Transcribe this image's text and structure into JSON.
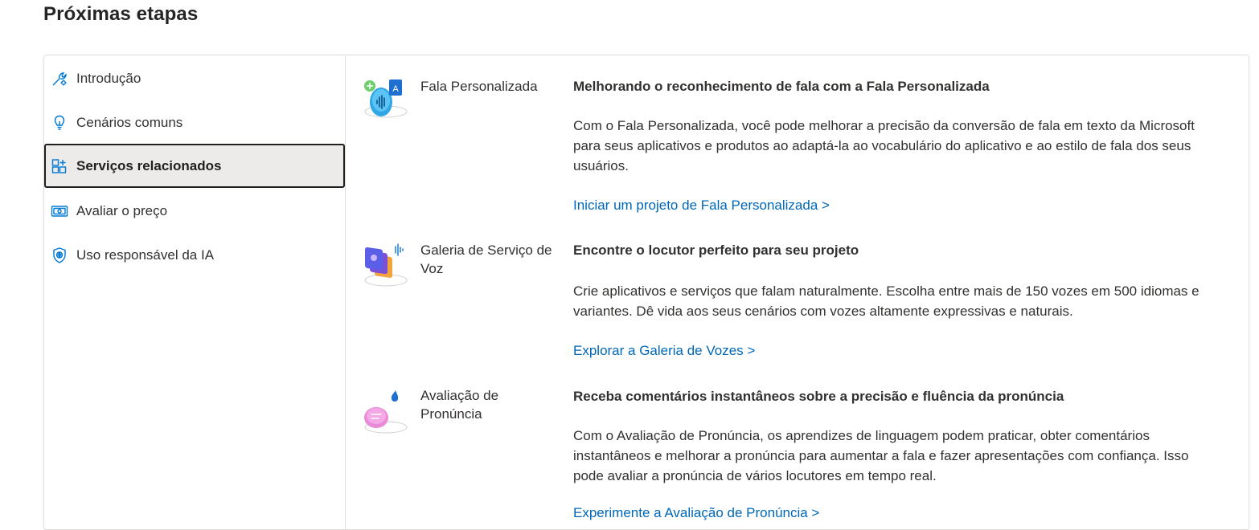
{
  "page": {
    "title": "Próximas etapas"
  },
  "sidebar": {
    "items": [
      {
        "label": "Introdução",
        "icon": "wrench-gear-icon",
        "active": false
      },
      {
        "label": "Cenários comuns",
        "icon": "lightbulb-icon",
        "active": false
      },
      {
        "label": "Serviços relacionados",
        "icon": "grid-add-icon",
        "active": true
      },
      {
        "label": "Avaliar o preço",
        "icon": "money-icon",
        "active": false
      },
      {
        "label": "Uso responsável da IA",
        "icon": "shield-globe-icon",
        "active": false
      }
    ]
  },
  "services": [
    {
      "name": "Fala Personalizada",
      "heading": "Melhorando o reconhecimento de fala com a Fala Personalizada",
      "description": "Com o Fala Personalizada, você pode melhorar a precisão da conversão de fala em texto da Microsoft para seus aplicativos e produtos ao adaptá-la ao vocabulário do aplicativo e ao estilo de fala dos seus usuários.",
      "link": "Iniciar um projeto de Fala Personalizada >",
      "illustration": "custom-speech-illustration"
    },
    {
      "name": "Galeria de Serviço de Voz",
      "heading": "Encontre o locutor perfeito para seu projeto",
      "description": "Crie aplicativos e serviços que falam naturalmente. Escolha entre mais de 150 vozes em 500 idiomas e variantes. Dê vida aos seus cenários com vozes altamente expressivas e naturais.",
      "link": "Explorar a Galeria de Vozes >",
      "illustration": "voice-gallery-illustration"
    },
    {
      "name": "Avaliação de Pronúncia",
      "heading": "Receba comentários instantâneos sobre a precisão e fluência da pronúncia",
      "description": "Com o Avaliação de Pronúncia, os aprendizes de linguagem podem praticar, obter comentários instantâneos e melhorar a pronúncia para aumentar a fala e fazer apresentações com confiança. Isso pode avaliar a pronúncia de vários locutores em tempo real.",
      "link": "Experimente a Avaliação de Pronúncia >",
      "illustration": "pronunciation-illustration"
    }
  ],
  "colors": {
    "link": "#0067b8",
    "active_border": "#201f1e",
    "active_bg": "#edebe9",
    "icon_blue": "#0078d4"
  }
}
